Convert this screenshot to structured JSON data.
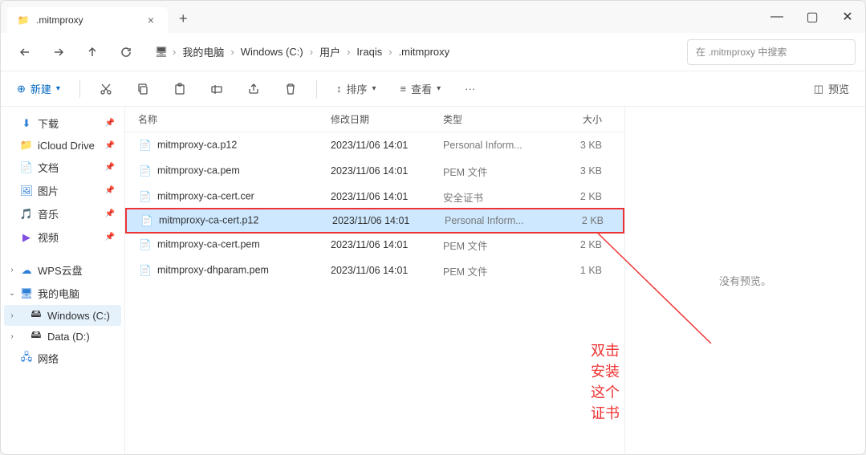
{
  "tab": {
    "title": ".mitmproxy"
  },
  "win_controls": {
    "min": "—",
    "max": "▢",
    "close": "✕"
  },
  "nav": {
    "breadcrumb": [
      {
        "label": "我的电脑"
      },
      {
        "label": "Windows (C:)"
      },
      {
        "label": "用户"
      },
      {
        "label": "Iraqis"
      },
      {
        "label": ".mitmproxy"
      }
    ]
  },
  "search": {
    "placeholder": "在 .mitmproxy 中搜索"
  },
  "toolbar": {
    "new": "新建",
    "sort": "排序",
    "view": "查看",
    "preview": "预览"
  },
  "sidebar": {
    "items": [
      {
        "icon": "download",
        "label": "下载",
        "pin": true
      },
      {
        "icon": "cloud",
        "label": "iCloud Drive",
        "pin": true,
        "iconColor": "ic-blue"
      },
      {
        "icon": "doc",
        "label": "文档",
        "pin": true
      },
      {
        "icon": "pic",
        "label": "图片",
        "pin": true,
        "iconColor": "ic-blue"
      },
      {
        "icon": "music",
        "label": "音乐",
        "pin": true,
        "iconColor": "ic-orange"
      },
      {
        "icon": "video",
        "label": "视频",
        "pin": true,
        "iconColor": "ic-purple"
      }
    ],
    "groups": [
      {
        "icon": "cloud",
        "label": "WPS云盘",
        "expand": ">",
        "iconColor": "ic-blue"
      },
      {
        "icon": "pc",
        "label": "我的电脑",
        "expand": "v",
        "iconColor": "ic-blue"
      }
    ],
    "drives": [
      {
        "icon": "disk",
        "label": "Windows (C:)",
        "selected": true
      },
      {
        "icon": "disk",
        "label": "Data (D:)"
      }
    ],
    "network": {
      "icon": "net",
      "label": "网络",
      "iconColor": "ic-blue"
    }
  },
  "columns": {
    "name": "名称",
    "date": "修改日期",
    "type": "类型",
    "size": "大小"
  },
  "files": [
    {
      "name": "mitmproxy-ca.p12",
      "date": "2023/11/06 14:01",
      "type": "Personal Inform...",
      "size": "3 KB",
      "icon": "cert"
    },
    {
      "name": "mitmproxy-ca.pem",
      "date": "2023/11/06 14:01",
      "type": "PEM 文件",
      "size": "3 KB",
      "icon": "file"
    },
    {
      "name": "mitmproxy-ca-cert.cer",
      "date": "2023/11/06 14:01",
      "type": "安全证书",
      "size": "2 KB",
      "icon": "cert"
    },
    {
      "name": "mitmproxy-ca-cert.p12",
      "date": "2023/11/06 14:01",
      "type": "Personal Inform...",
      "size": "2 KB",
      "icon": "cert",
      "selected": true
    },
    {
      "name": "mitmproxy-ca-cert.pem",
      "date": "2023/11/06 14:01",
      "type": "PEM 文件",
      "size": "2 KB",
      "icon": "file"
    },
    {
      "name": "mitmproxy-dhparam.pem",
      "date": "2023/11/06 14:01",
      "type": "PEM 文件",
      "size": "1 KB",
      "icon": "file"
    }
  ],
  "preview_text": "没有预览。",
  "annotation": "双击安装这个证书"
}
